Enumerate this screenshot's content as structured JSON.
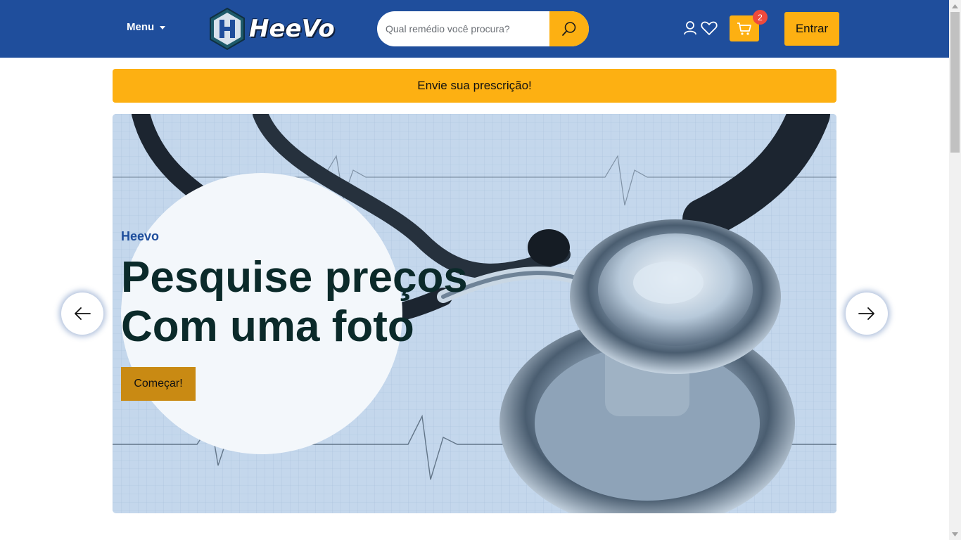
{
  "header": {
    "menu_label": "Menu",
    "logo_text": "HeeVo",
    "search_placeholder": "Qual remédio você procura?",
    "cart_count": "2",
    "login_label": "Entrar"
  },
  "prescription": {
    "label": "Envie sua prescrição!"
  },
  "hero": {
    "brand": "Heevo",
    "title_line1": "Pesquise preços",
    "title_line2": "Com uma foto",
    "cta_label": "Começar!"
  },
  "colors": {
    "header_bg": "#1f4e9c",
    "accent": "#fdb012",
    "cta": "#c98a13",
    "badge": "#ee4a3c"
  },
  "icons": {
    "menu": "caret-down-icon",
    "search": "search-icon",
    "user": "user-icon",
    "wishlist": "heart-icon",
    "cart": "cart-icon",
    "prev": "arrow-left-icon",
    "next": "arrow-right-icon"
  }
}
